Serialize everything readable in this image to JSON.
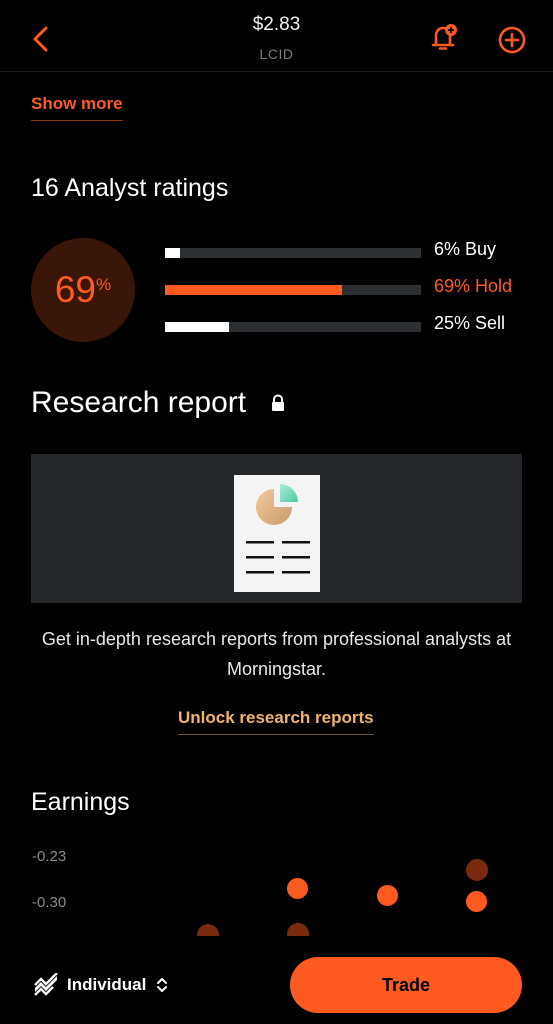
{
  "header": {
    "price": "$2.83",
    "ticker": "LCID",
    "back_icon": "chevron-left-icon",
    "alert_icon": "bell-plus-icon",
    "add_icon": "plus-circle-icon",
    "accent_color": "#ff5a1f"
  },
  "show_more": {
    "label": "Show more"
  },
  "analyst": {
    "title": "16 Analyst ratings",
    "headline_value": "69",
    "headline_unit": "%",
    "ratings": [
      {
        "label": "6% Buy",
        "fraction": 0.06,
        "color": "#ffffff",
        "label_color": "#ffffff"
      },
      {
        "label": "69% Hold",
        "fraction": 0.69,
        "color": "#ff5a1f",
        "label_color": "#ff5a1f"
      },
      {
        "label": "25% Sell",
        "fraction": 0.25,
        "color": "#ffffff",
        "label_color": "#ffffff"
      }
    ]
  },
  "research": {
    "title": "Research report",
    "lock_icon": "lock-icon",
    "illustration": "report-document-illustration",
    "description": "Get in-depth research reports from professional analysts at Morningstar.",
    "unlock_label": "Unlock research reports"
  },
  "earnings": {
    "title": "Earnings",
    "y_ticks": [
      "-0.23",
      "-0.30"
    ]
  },
  "bottom_bar": {
    "account_icon": "portfolio-chart-icon",
    "account_label": "Individual",
    "account_chevron_icon": "up-down-chevron-icon",
    "trade_label": "Trade"
  }
}
